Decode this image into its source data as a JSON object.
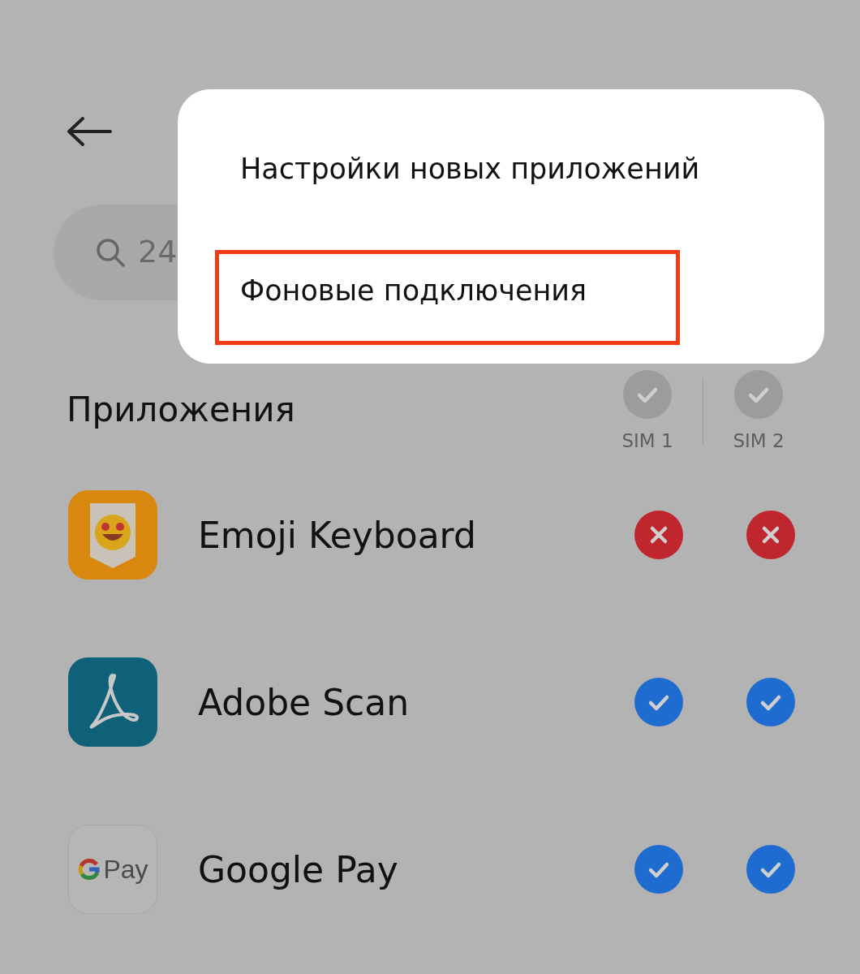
{
  "search": {
    "value": "24"
  },
  "section": {
    "title": "Приложения"
  },
  "sim_columns": [
    {
      "label": "SIM 1",
      "checked": false
    },
    {
      "label": "SIM 2",
      "checked": false
    }
  ],
  "apps": [
    {
      "name": "Emoji Keyboard",
      "kind": "emoji",
      "sims": [
        {
          "allowed": false
        },
        {
          "allowed": false
        }
      ]
    },
    {
      "name": "Adobe Scan",
      "kind": "adobe",
      "sims": [
        {
          "allowed": true
        },
        {
          "allowed": true
        }
      ]
    },
    {
      "name": "Google Pay",
      "kind": "gpay",
      "icon_text": "Pay",
      "sims": [
        {
          "allowed": true
        },
        {
          "allowed": true
        }
      ]
    }
  ],
  "menu": {
    "items": [
      {
        "label": "Настройки новых приложений",
        "highlighted": false
      },
      {
        "label": "Фоновые подключения",
        "highlighted": true
      }
    ]
  }
}
